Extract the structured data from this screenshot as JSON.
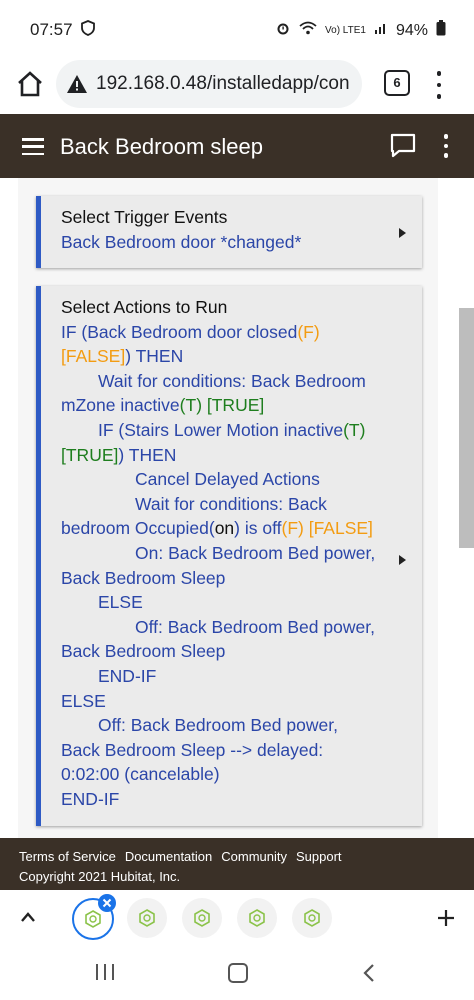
{
  "status_bar": {
    "time": "07:57",
    "network_label": "Vo) LTE1",
    "battery": "94%"
  },
  "browser": {
    "url": "192.168.0.48/installedapp/con",
    "tab_count": "6"
  },
  "app_header": {
    "title": "Back Bedroom sleep"
  },
  "trigger_card": {
    "heading": "Select Trigger Events",
    "text": "Back Bedroom door *changed*"
  },
  "actions_card": {
    "heading": "Select Actions to Run",
    "l1a": "IF (Back Bedroom door closed",
    "l1b": "(F)",
    "l2a": "[FALSE]",
    "l2b": ") THEN",
    "l3": "Wait for conditions: Back Bedroom",
    "l4a": "mZone inactive",
    "l4b": "(T) [TRUE]",
    "l5a": "IF (Stairs Lower Motion inactive",
    "l5b": "(T)",
    "l6a": "[TRUE]",
    "l6b": ") THEN",
    "l7": "Cancel Delayed Actions",
    "l8": "Wait for conditions: Back",
    "l9a": "bedroom Occupied(",
    "l9b": "on",
    "l9c": ") is off",
    "l9d": "(F) [FALSE]",
    "l10": "On: Back Bedroom Bed power,",
    "l11": "Back Bedroom Sleep",
    "l12": "ELSE",
    "l13": "Off: Back Bedroom Bed power,",
    "l14": "Back Bedroom Sleep",
    "l15": "END-IF",
    "l16": "ELSE",
    "l17": "Off: Back Bedroom Bed power,",
    "l18": "Back Bedroom Sleep --> delayed:",
    "l19": "0:02:00 (cancelable)",
    "l20": "END-IF"
  },
  "footer": {
    "links": [
      "Terms of Service",
      "Documentation",
      "Community",
      "Support"
    ],
    "copyright": "Copyright 2021 Hubitat, Inc."
  },
  "colors": {
    "header_bg": "#3a3027",
    "card_accent": "#2e5ac4",
    "link_blue": "#2b46a8",
    "false_orange": "#f39c12",
    "true_green": "#1e7e1e"
  },
  "icons": [
    "home-icon",
    "warning-icon",
    "chat-icon",
    "hamburger-icon",
    "kebab-menu-icon",
    "hubitat-favicon",
    "chevron-up-icon",
    "plus-icon",
    "recent-apps-icon",
    "home-nav-icon",
    "back-icon"
  ]
}
